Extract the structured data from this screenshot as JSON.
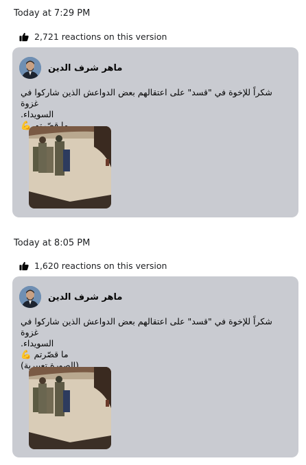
{
  "versions": [
    {
      "time": "Today at 7:29 PM",
      "reactions": "2,721 reactions on this version",
      "author": "ماهر شرف الدين",
      "lines": [
        "شكراً للإخوة في \"قسد\" على اعتقالهم بعض الدواعش الذين شاركوا في غزوة",
        "السويداء.",
        "ما قصّرتم 💪"
      ]
    },
    {
      "time": "Today at 8:05 PM",
      "reactions": "1,620 reactions on this version",
      "author": "ماهر شرف الدين",
      "lines": [
        "شكراً للإخوة في \"قسد\" على اعتقالهم بعض الدواعش الذين شاركوا في غزوة",
        "السويداء.",
        "ما قصّرتم 💪",
        "(الصورة تعبيرية)"
      ]
    }
  ],
  "icons": {
    "reaction": "thumbs-up-icon"
  },
  "colors": {
    "card_background": "#c9cbd1"
  }
}
